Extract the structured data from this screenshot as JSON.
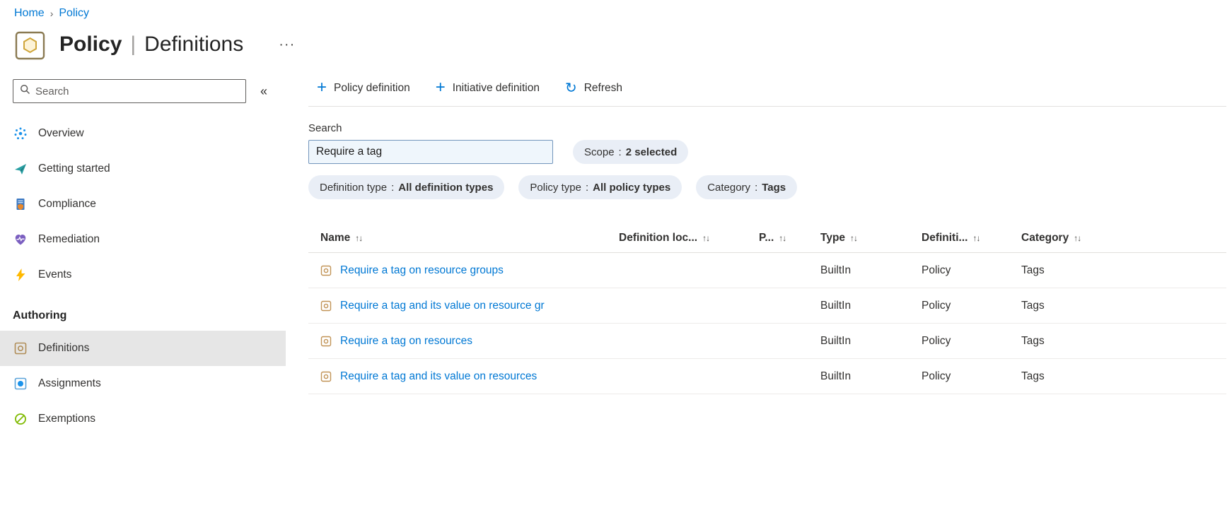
{
  "colors": {
    "link": "#0078d4",
    "accent": "#0078d4",
    "selected_bg": "#e6e6e6",
    "pill_bg": "#e9eef6"
  },
  "breadcrumb": {
    "home": "Home",
    "separator": "›",
    "current": "Policy"
  },
  "header": {
    "title_primary": "Policy",
    "title_separator": "|",
    "title_secondary": "Definitions",
    "more_label": "···"
  },
  "sidebar": {
    "search_placeholder": "Search",
    "collapse_glyph": "«",
    "items": [
      {
        "label": "Overview",
        "icon": "overview-icon"
      },
      {
        "label": "Getting started",
        "icon": "getting-started-icon"
      },
      {
        "label": "Compliance",
        "icon": "compliance-icon"
      },
      {
        "label": "Remediation",
        "icon": "remediation-icon"
      },
      {
        "label": "Events",
        "icon": "events-icon"
      }
    ],
    "section_label": "Authoring",
    "authoring": [
      {
        "label": "Definitions",
        "icon": "definitions-icon",
        "selected": true
      },
      {
        "label": "Assignments",
        "icon": "assignments-icon",
        "selected": false
      },
      {
        "label": "Exemptions",
        "icon": "exemptions-icon",
        "selected": false
      }
    ]
  },
  "toolbar": {
    "plus_glyph": "+",
    "refresh_glyph": "↻",
    "policy_definition_label": "Policy definition",
    "initiative_definition_label": "Initiative definition",
    "refresh_label": "Refresh"
  },
  "filters": {
    "search_label": "Search",
    "search_value": "Require a tag",
    "scope_pill": {
      "name": "Scope",
      "separator": ":",
      "value": "2 selected"
    },
    "pills": [
      {
        "name": "Definition type",
        "separator": ":",
        "value": "All definition types"
      },
      {
        "name": "Policy type",
        "separator": ":",
        "value": "All policy types"
      },
      {
        "name": "Category",
        "separator": ":",
        "value": "Tags"
      }
    ]
  },
  "table": {
    "sort_glyph": "↑↓",
    "columns": [
      {
        "label": "Name"
      },
      {
        "label": "Definition loc..."
      },
      {
        "label": "P..."
      },
      {
        "label": "Type"
      },
      {
        "label": "Definiti..."
      },
      {
        "label": "Category"
      }
    ],
    "rows": [
      {
        "name": "Require a tag on resource groups",
        "definition_location": "",
        "policies": "",
        "type": "BuiltIn",
        "definition_type": "Policy",
        "category": "Tags"
      },
      {
        "name": "Require a tag and its value on resource gr",
        "definition_location": "",
        "policies": "",
        "type": "BuiltIn",
        "definition_type": "Policy",
        "category": "Tags"
      },
      {
        "name": "Require a tag on resources",
        "definition_location": "",
        "policies": "",
        "type": "BuiltIn",
        "definition_type": "Policy",
        "category": "Tags"
      },
      {
        "name": "Require a tag and its value on resources",
        "definition_location": "",
        "policies": "",
        "type": "BuiltIn",
        "definition_type": "Policy",
        "category": "Tags"
      }
    ]
  }
}
